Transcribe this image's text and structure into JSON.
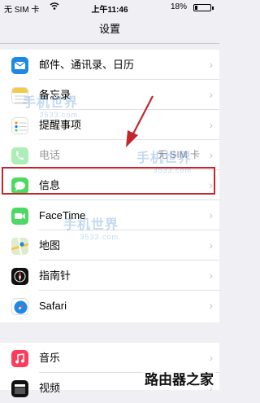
{
  "status": {
    "carrier": "无 SIM 卡",
    "time": "上午11:46",
    "battery": "18%",
    "battery_level": 0.18
  },
  "nav": {
    "title": "设置"
  },
  "groups": [
    {
      "rows": [
        {
          "label": "邮件、通讯录、日历",
          "icon": "mail-icon"
        },
        {
          "label": "备忘录",
          "icon": "notes-icon"
        },
        {
          "label": "提醒事项",
          "icon": "reminders-icon"
        },
        {
          "label": "电话",
          "value": "无 SIM 卡",
          "icon": "phone-icon"
        },
        {
          "label": "信息",
          "icon": "messages-icon"
        },
        {
          "label": "FaceTime",
          "icon": "facetime-icon"
        },
        {
          "label": "地图",
          "icon": "maps-icon"
        },
        {
          "label": "指南针",
          "icon": "compass-icon"
        },
        {
          "label": "Safari",
          "icon": "safari-icon"
        }
      ]
    },
    {
      "rows": [
        {
          "label": "音乐",
          "icon": "music-icon"
        },
        {
          "label": "视频",
          "icon": "videos-icon"
        }
      ]
    }
  ],
  "watermarks": {
    "brand": "手机世界",
    "sub": "3533.com"
  },
  "corner_watermark": "路由器之家",
  "colors": {
    "highlight": "#c1272d",
    "accent": "#007aff"
  }
}
